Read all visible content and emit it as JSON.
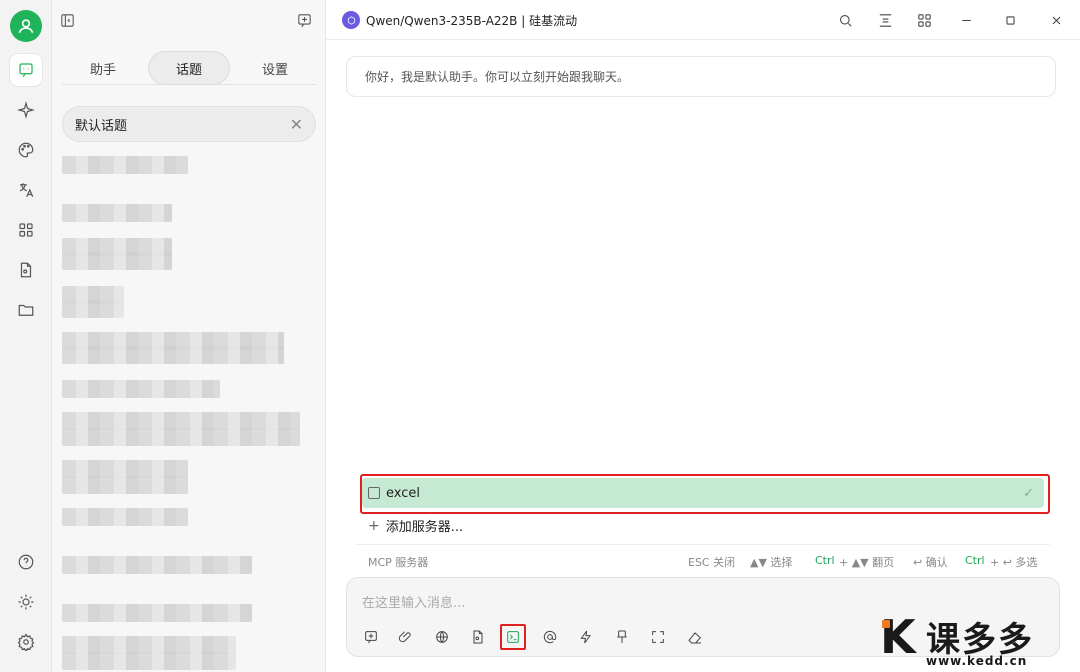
{
  "app": {
    "model_title": "Qwen/Qwen3-235B-A22B | 硅基流动"
  },
  "rail": {
    "items": [
      "avatar",
      "chat",
      "agents",
      "paint",
      "translate",
      "apps",
      "files",
      "folder"
    ],
    "bottom": [
      "help",
      "theme",
      "settings"
    ]
  },
  "panel": {
    "tabs": [
      {
        "label": "助手"
      },
      {
        "label": "话题"
      },
      {
        "label": "设置"
      }
    ],
    "active_tab": "话题",
    "current_topic": "默认话题"
  },
  "chat": {
    "welcome": "你好，我是默认助手。你可以立刻开始跟我聊天。"
  },
  "mcp": {
    "server_name": "excel",
    "add_label": "添加服务器...",
    "footer": {
      "title": "MCP 服务器",
      "esc": "ESC 关闭",
      "select": "▲▼ 选择",
      "ctrl1": "Ctrl",
      "page": "+ ▲▼ 翻页",
      "confirm": "↩ 确认",
      "ctrl2": "Ctrl",
      "multi": "+ ↩ 多选"
    }
  },
  "input": {
    "placeholder": "在这里输入消息..."
  },
  "watermark": {
    "name": "课多多",
    "url": "www.kedd.cn"
  },
  "colors": {
    "accent": "#1fb35a",
    "highlight": "#c6e9d4",
    "annotation": "#e02020"
  }
}
